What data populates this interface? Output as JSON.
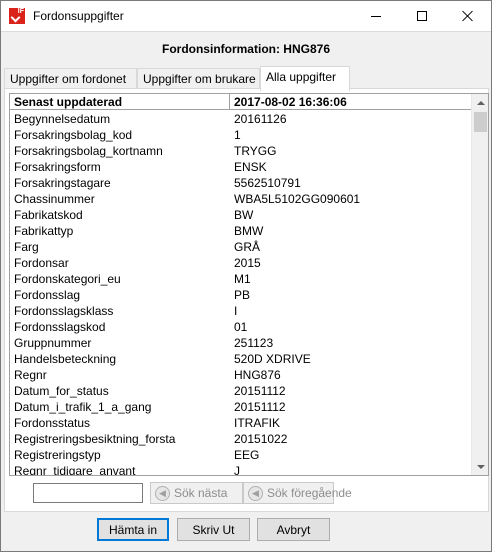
{
  "window": {
    "title": "Fordonsuppgifter",
    "icon_text": "IF"
  },
  "header": {
    "title": "Fordonsinformation: HNG876"
  },
  "tabs": [
    {
      "label": "Uppgifter om fordonet",
      "active": false
    },
    {
      "label": "Uppgifter om brukare",
      "active": false
    },
    {
      "label": "Alla uppgifter",
      "active": true
    }
  ],
  "grid": {
    "header": {
      "key": "Senast uppdaterad",
      "value": "2017-08-02 16:36:06"
    },
    "rows": [
      {
        "key": "Begynnelsedatum",
        "value": "20161126"
      },
      {
        "key": "Forsakringsbolag_kod",
        "value": "1"
      },
      {
        "key": "Forsakringsbolag_kortnamn",
        "value": "TRYGG"
      },
      {
        "key": "Forsakringsform",
        "value": "ENSK"
      },
      {
        "key": "Forsakringstagare",
        "value": "5562510791"
      },
      {
        "key": "Chassinummer",
        "value": "WBA5L5102GG090601"
      },
      {
        "key": "Fabrikatskod",
        "value": "BW"
      },
      {
        "key": "Fabrikattyp",
        "value": "BMW"
      },
      {
        "key": "Farg",
        "value": "GRÅ"
      },
      {
        "key": "Fordonsar",
        "value": "2015"
      },
      {
        "key": "Fordonskategori_eu",
        "value": "M1"
      },
      {
        "key": "Fordonsslag",
        "value": "PB"
      },
      {
        "key": "Fordonsslagsklass",
        "value": "I"
      },
      {
        "key": "Fordonsslagskod",
        "value": "01"
      },
      {
        "key": "Gruppnummer",
        "value": "251123"
      },
      {
        "key": "Handelsbeteckning",
        "value": "520D XDRIVE"
      },
      {
        "key": "Regnr",
        "value": "HNG876"
      },
      {
        "key": "Datum_for_status",
        "value": "20151112"
      },
      {
        "key": "Datum_i_trafik_1_a_gang",
        "value": "20151112"
      },
      {
        "key": "Fordonsstatus",
        "value": "ITRAFIK"
      },
      {
        "key": "Registreringsbesiktning_forsta",
        "value": "20151022"
      },
      {
        "key": "Registreringstyp",
        "value": "EEG"
      },
      {
        "key": "Regnr_tidigare_anvant",
        "value": "J"
      }
    ]
  },
  "search": {
    "value": "",
    "next_label": "Sök nästa",
    "prev_label": "Sök föregående"
  },
  "buttons": {
    "fetch": "Hämta in",
    "print": "Skriv Ut",
    "cancel": "Avbryt"
  },
  "colors": {
    "icon_red": "#d9231b",
    "default_button_border": "#0078d7"
  }
}
